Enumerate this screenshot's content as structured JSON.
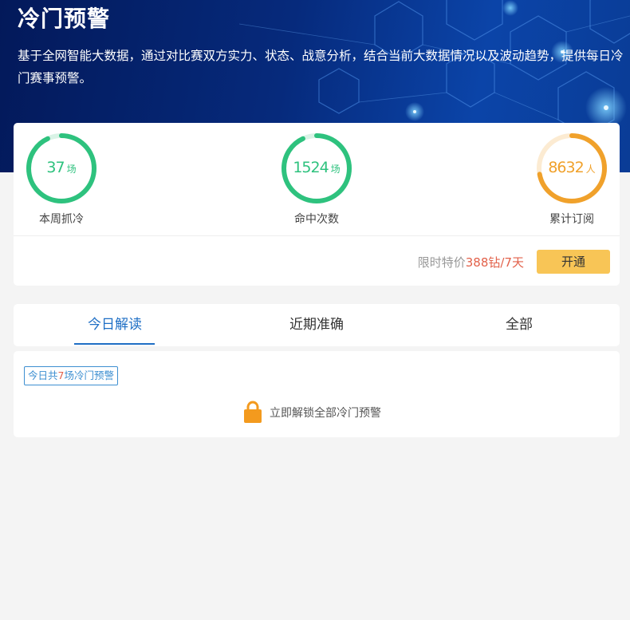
{
  "header": {
    "title": "冷门预警",
    "description": "基于全网智能大数据，通过对比赛双方实力、状态、战意分析，结合当前大数据情况以及波动趋势，提供每日冷门赛事预警。"
  },
  "stats": [
    {
      "value": "37",
      "unit": "场",
      "label": "本周抓冷",
      "progress": 0.93,
      "color": "#2ec27e",
      "track": "#d9f3e6"
    },
    {
      "value": "1524",
      "unit": "场",
      "label": "命中次数",
      "progress": 0.93,
      "color": "#2ec27e",
      "track": "#d9f3e6"
    },
    {
      "value": "8632",
      "unit": "人",
      "label": "累计订阅",
      "progress": 0.72,
      "color": "#f0a12b",
      "track": "#fcebd2"
    }
  ],
  "offer": {
    "prefix": "限时特价",
    "price": "388钻/7天",
    "button_label": "开通"
  },
  "tabs": [
    {
      "label": "今日解读",
      "active": true
    },
    {
      "label": "近期准确",
      "active": false
    },
    {
      "label": "全部",
      "active": false
    }
  ],
  "today": {
    "badge_prefix": "今日共",
    "badge_count": "7",
    "badge_suffix": "场冷门预警",
    "unlock_text": "立即解锁全部冷门预警",
    "unlock_icon": "lock-icon"
  },
  "colors": {
    "accent_blue": "#1f6fc5",
    "price_red": "#e2614a",
    "button_yellow": "#f8c556",
    "lock_orange": "#f39a1e"
  }
}
